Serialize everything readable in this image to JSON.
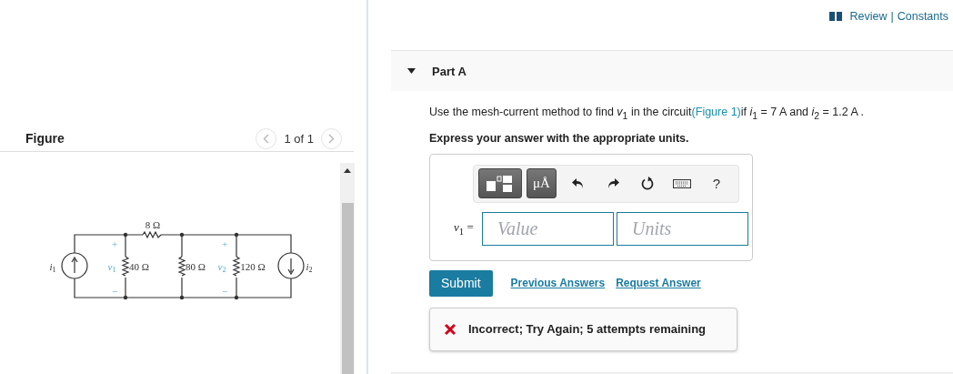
{
  "header": {
    "links": [
      {
        "label": "Review"
      },
      {
        "label": "Constants"
      }
    ],
    "separator": "|"
  },
  "figure_panel": {
    "title": "Figure",
    "pager": "1 of 1",
    "circuit_labels": [
      {
        "kind": "value",
        "text": "8 Ω"
      },
      {
        "kind": "sign",
        "text": "+"
      },
      {
        "kind": "sign",
        "text": "+"
      },
      {
        "kind": "var",
        "base": "i",
        "sub": "1"
      },
      {
        "kind": "var",
        "base": "v",
        "sub": "1"
      },
      {
        "kind": "value",
        "text": "40 Ω"
      },
      {
        "kind": "value",
        "text": "80 Ω"
      },
      {
        "kind": "var",
        "base": "v",
        "sub": "2"
      },
      {
        "kind": "value",
        "text": "120 Ω"
      },
      {
        "kind": "var",
        "base": "i",
        "sub": "2"
      },
      {
        "kind": "sign",
        "text": "−"
      },
      {
        "kind": "sign",
        "text": "−"
      }
    ]
  },
  "part": {
    "title": "Part A",
    "expanded": true,
    "question_before": "Use the mesh-current method to find *v*$_{1}$ in the circuit",
    "question_link": "(Figure 1)",
    "question_after": "if *i*$_{1}$ = 7 A and *i*$_{2}$ = 1.2 A .",
    "instruction": "Express your answer with the appropriate units.",
    "toolbar": [
      {
        "kind": "templates"
      },
      {
        "kind": "units",
        "label": "μÅ"
      },
      {
        "kind": "undo"
      },
      {
        "kind": "redo"
      },
      {
        "kind": "reset"
      },
      {
        "kind": "keyboard"
      },
      {
        "kind": "help",
        "label": "?"
      }
    ],
    "answer_label": "*v*$_{1}$ =",
    "value_placeholder": "Value",
    "units_placeholder": "Units",
    "submit": "Submit",
    "links": [
      "Previous Answers",
      "Request Answer"
    ],
    "feedback": {
      "kind": "incorrect",
      "text": "Incorrect; Try Again; 5 attempts remaining"
    }
  }
}
